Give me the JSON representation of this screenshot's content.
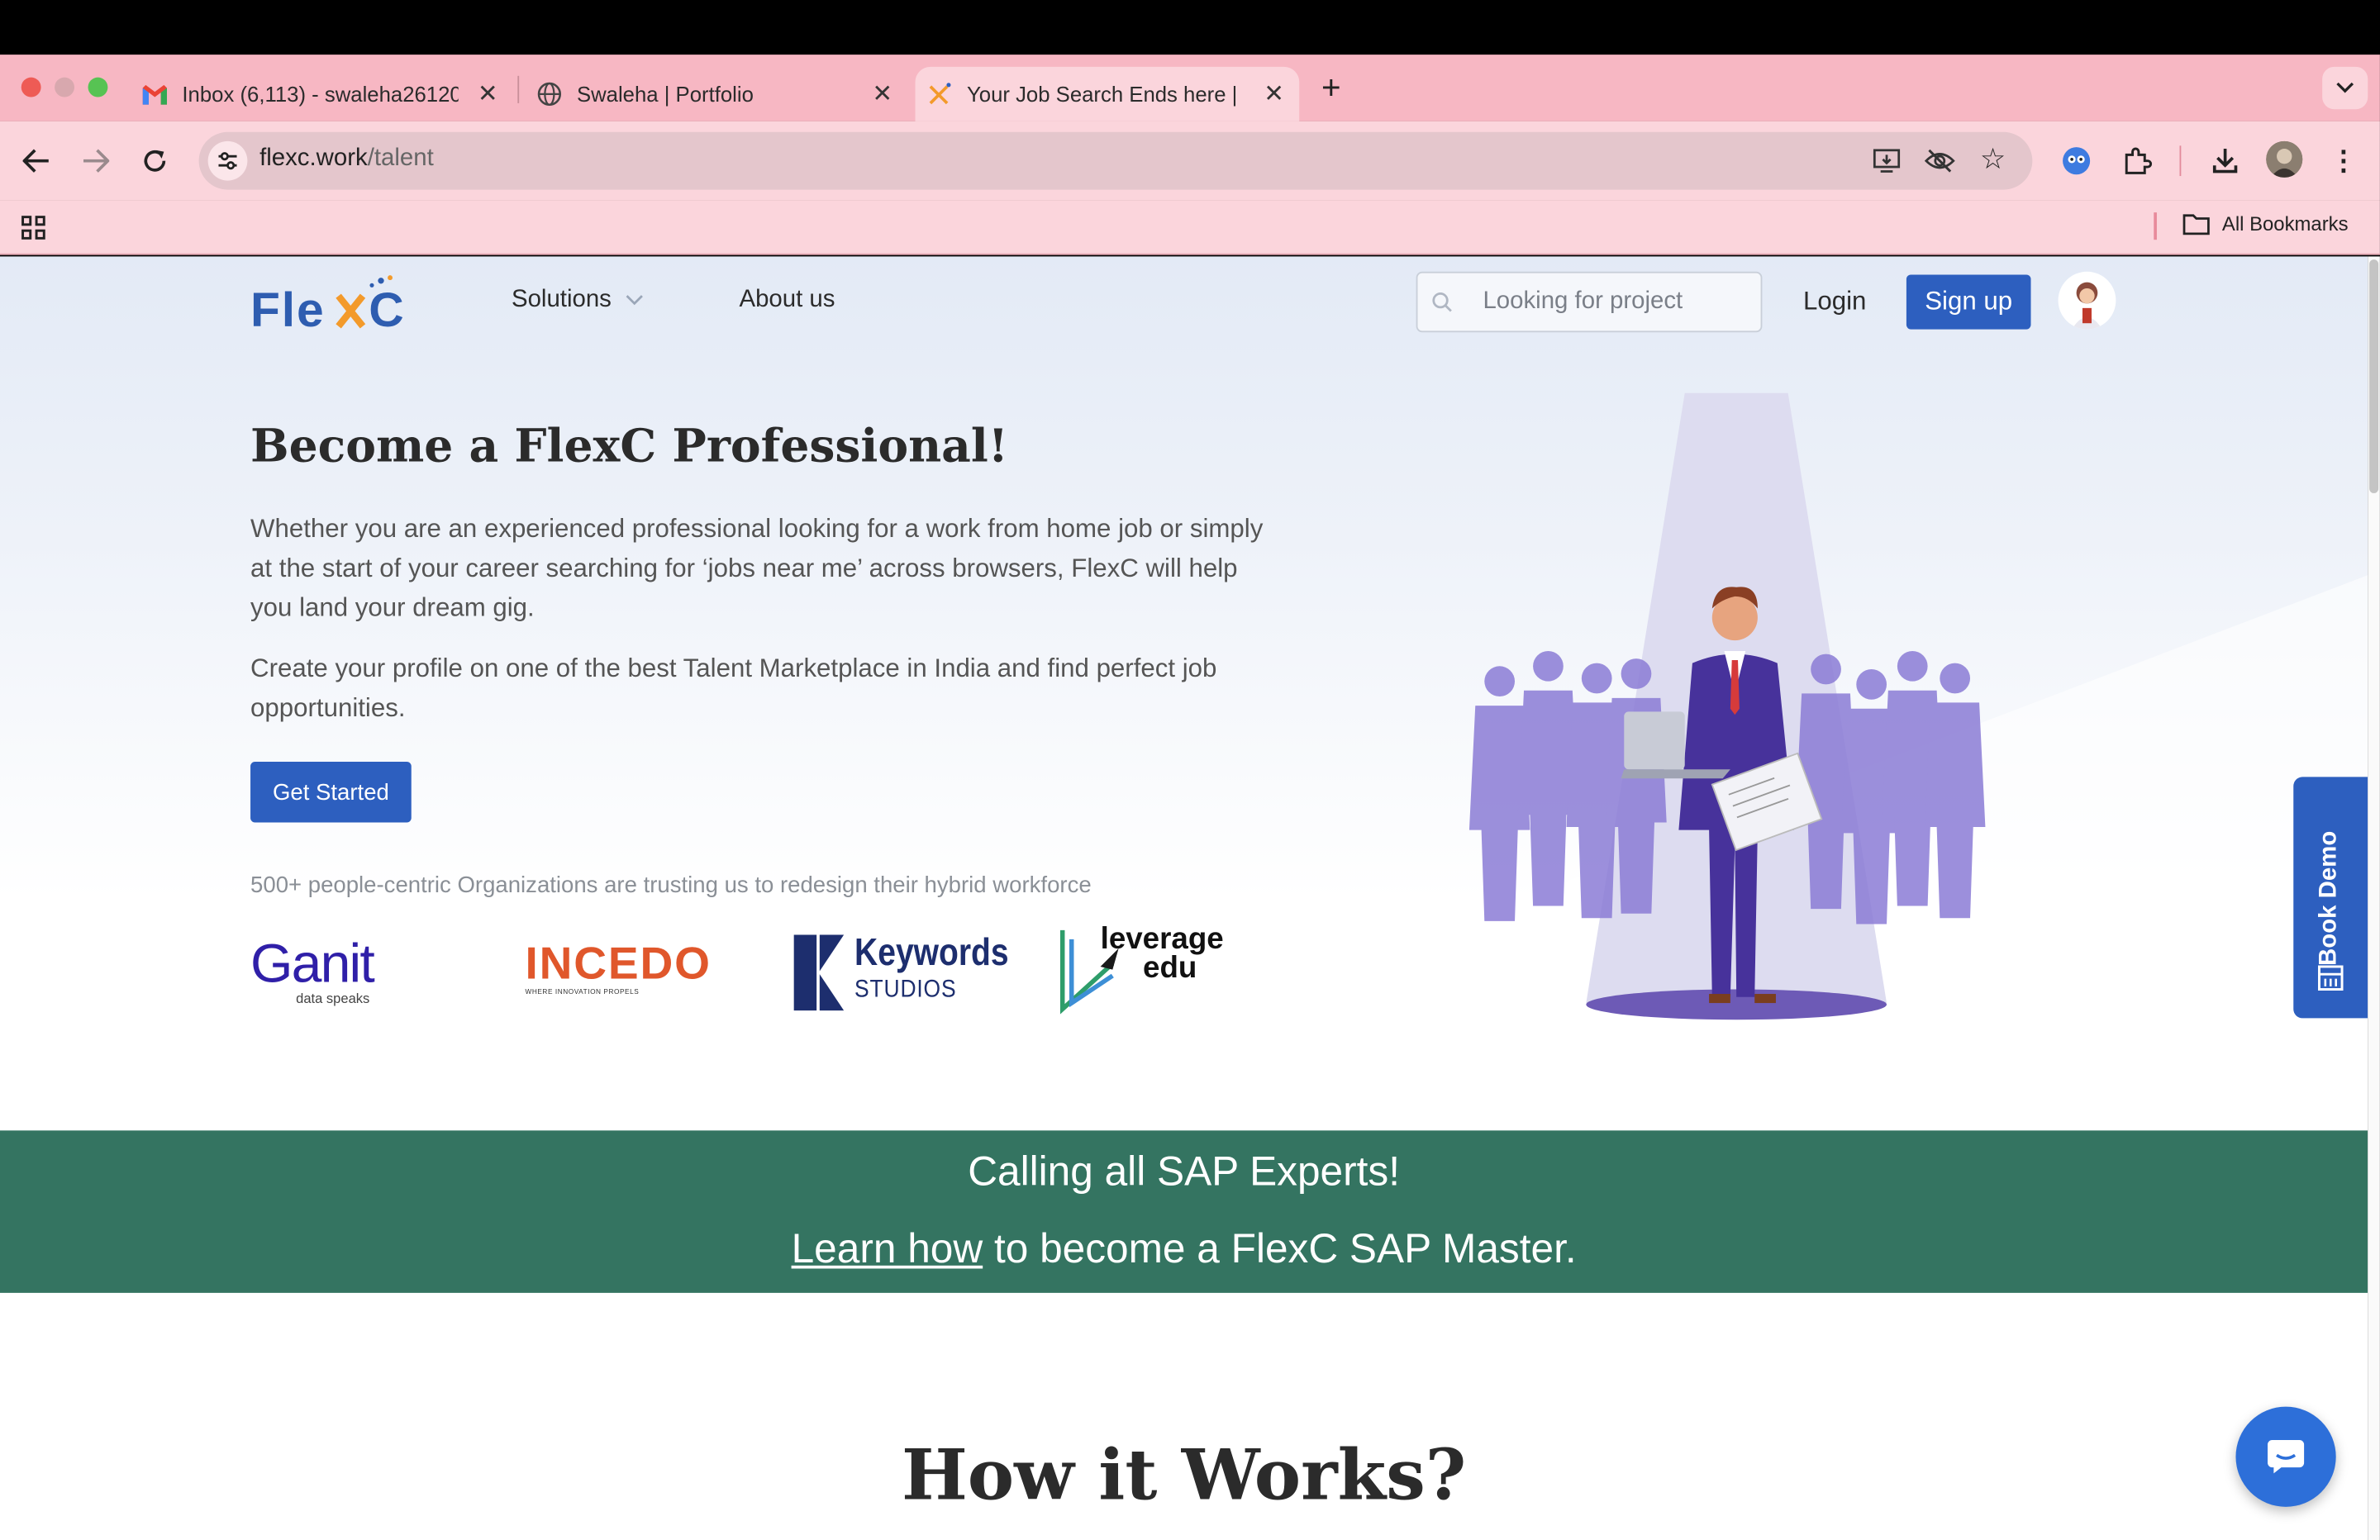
{
  "browser": {
    "tabs": [
      {
        "title": "Inbox (6,113) - swaleha26120",
        "favicon": "gmail-icon"
      },
      {
        "title": "Swaleha | Portfolio",
        "favicon": "globe-icon"
      },
      {
        "title": "Your Job Search Ends here | F",
        "favicon": "flexc-favicon",
        "active": true
      }
    ],
    "url_domain": "flexc.work",
    "url_path": "/talent",
    "bookmarks_label": "All Bookmarks"
  },
  "header": {
    "nav_solutions": "Solutions",
    "nav_about": "About us",
    "search_placeholder": "Looking for project",
    "login": "Login",
    "signup": "Sign up"
  },
  "hero": {
    "title": "Become a FlexC Professional!",
    "para1": "Whether you are an experienced professional looking for a work from home job or simply at the start of your career searching for ‘jobs near me’ across browsers, FlexC will help you land your dream gig.",
    "para2": "Create your profile on one of the best Talent Marketplace in India and find perfect job opportunities.",
    "cta": "Get Started",
    "trust_line": "500+ people-centric Organizations are trusting us to redesign their hybrid workforce"
  },
  "logos": {
    "ganit": "Ganit",
    "ganit_tag": "data speaks",
    "incedo": "incedo",
    "incedo_tag": "WHERE INNOVATION PROPELS",
    "keywords": "Keywords",
    "keywords_sub": "STUDIOS",
    "leverage1": "leverage",
    "leverage2": "edu"
  },
  "banner": {
    "line1": "Calling all SAP Experts!",
    "link": "Learn how",
    "line2_rest": " to become a FlexC SAP Master.",
    "bg": "#347461"
  },
  "book_demo": "Book Demo",
  "section_title": "How it Works?",
  "colors": {
    "primary": "#2d5fbf",
    "tabbar": "#f7b7c3",
    "toolbar": "#fbd5dc"
  }
}
